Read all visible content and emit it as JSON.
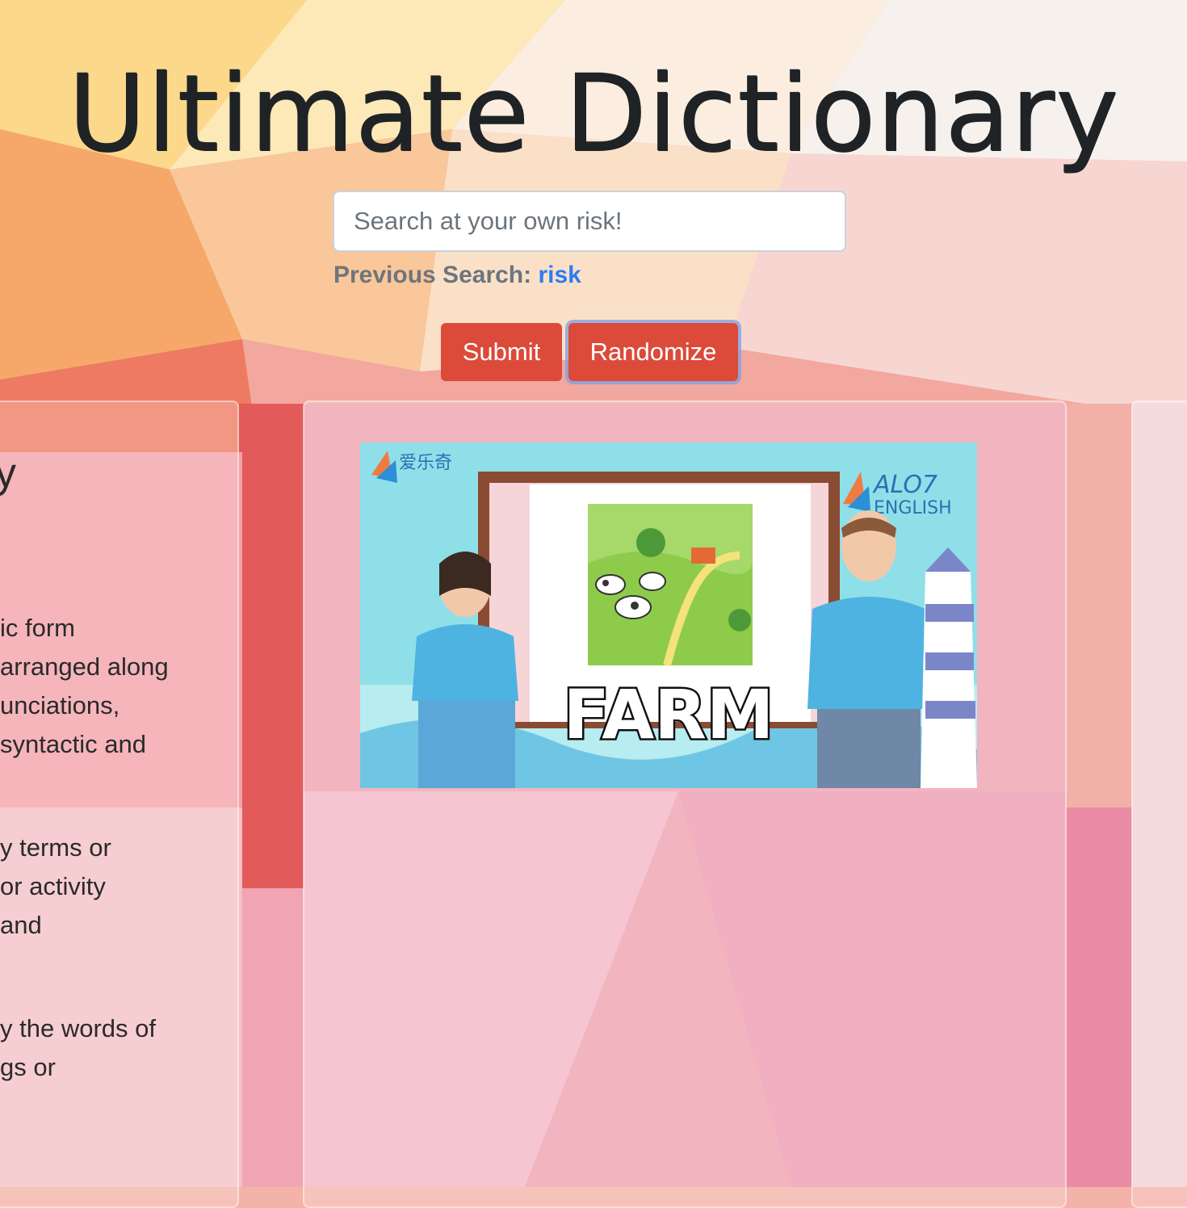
{
  "title": "Ultimate Dictionary",
  "search": {
    "placeholder": "Search at your own risk!",
    "value": ""
  },
  "previous_search": {
    "label": "Previous Search:",
    "word": "risk"
  },
  "buttons": {
    "submit": "Submit",
    "randomize": "Randomize"
  },
  "left_card": {
    "heading_fragment": "y",
    "lines": [
      "ic form",
      "arranged along",
      "unciations,",
      "syntactic and",
      "y terms or",
      "or activity",
      "and",
      "y the words of",
      "gs or"
    ]
  },
  "gif": {
    "logo_text": "爱乐奇",
    "brand_line1": "ALO7",
    "brand_line2": "ENGLISH",
    "caption": "FARM"
  },
  "colors": {
    "button": "#dc4a3a",
    "link": "#2a7ef2",
    "muted": "#6c757d"
  }
}
